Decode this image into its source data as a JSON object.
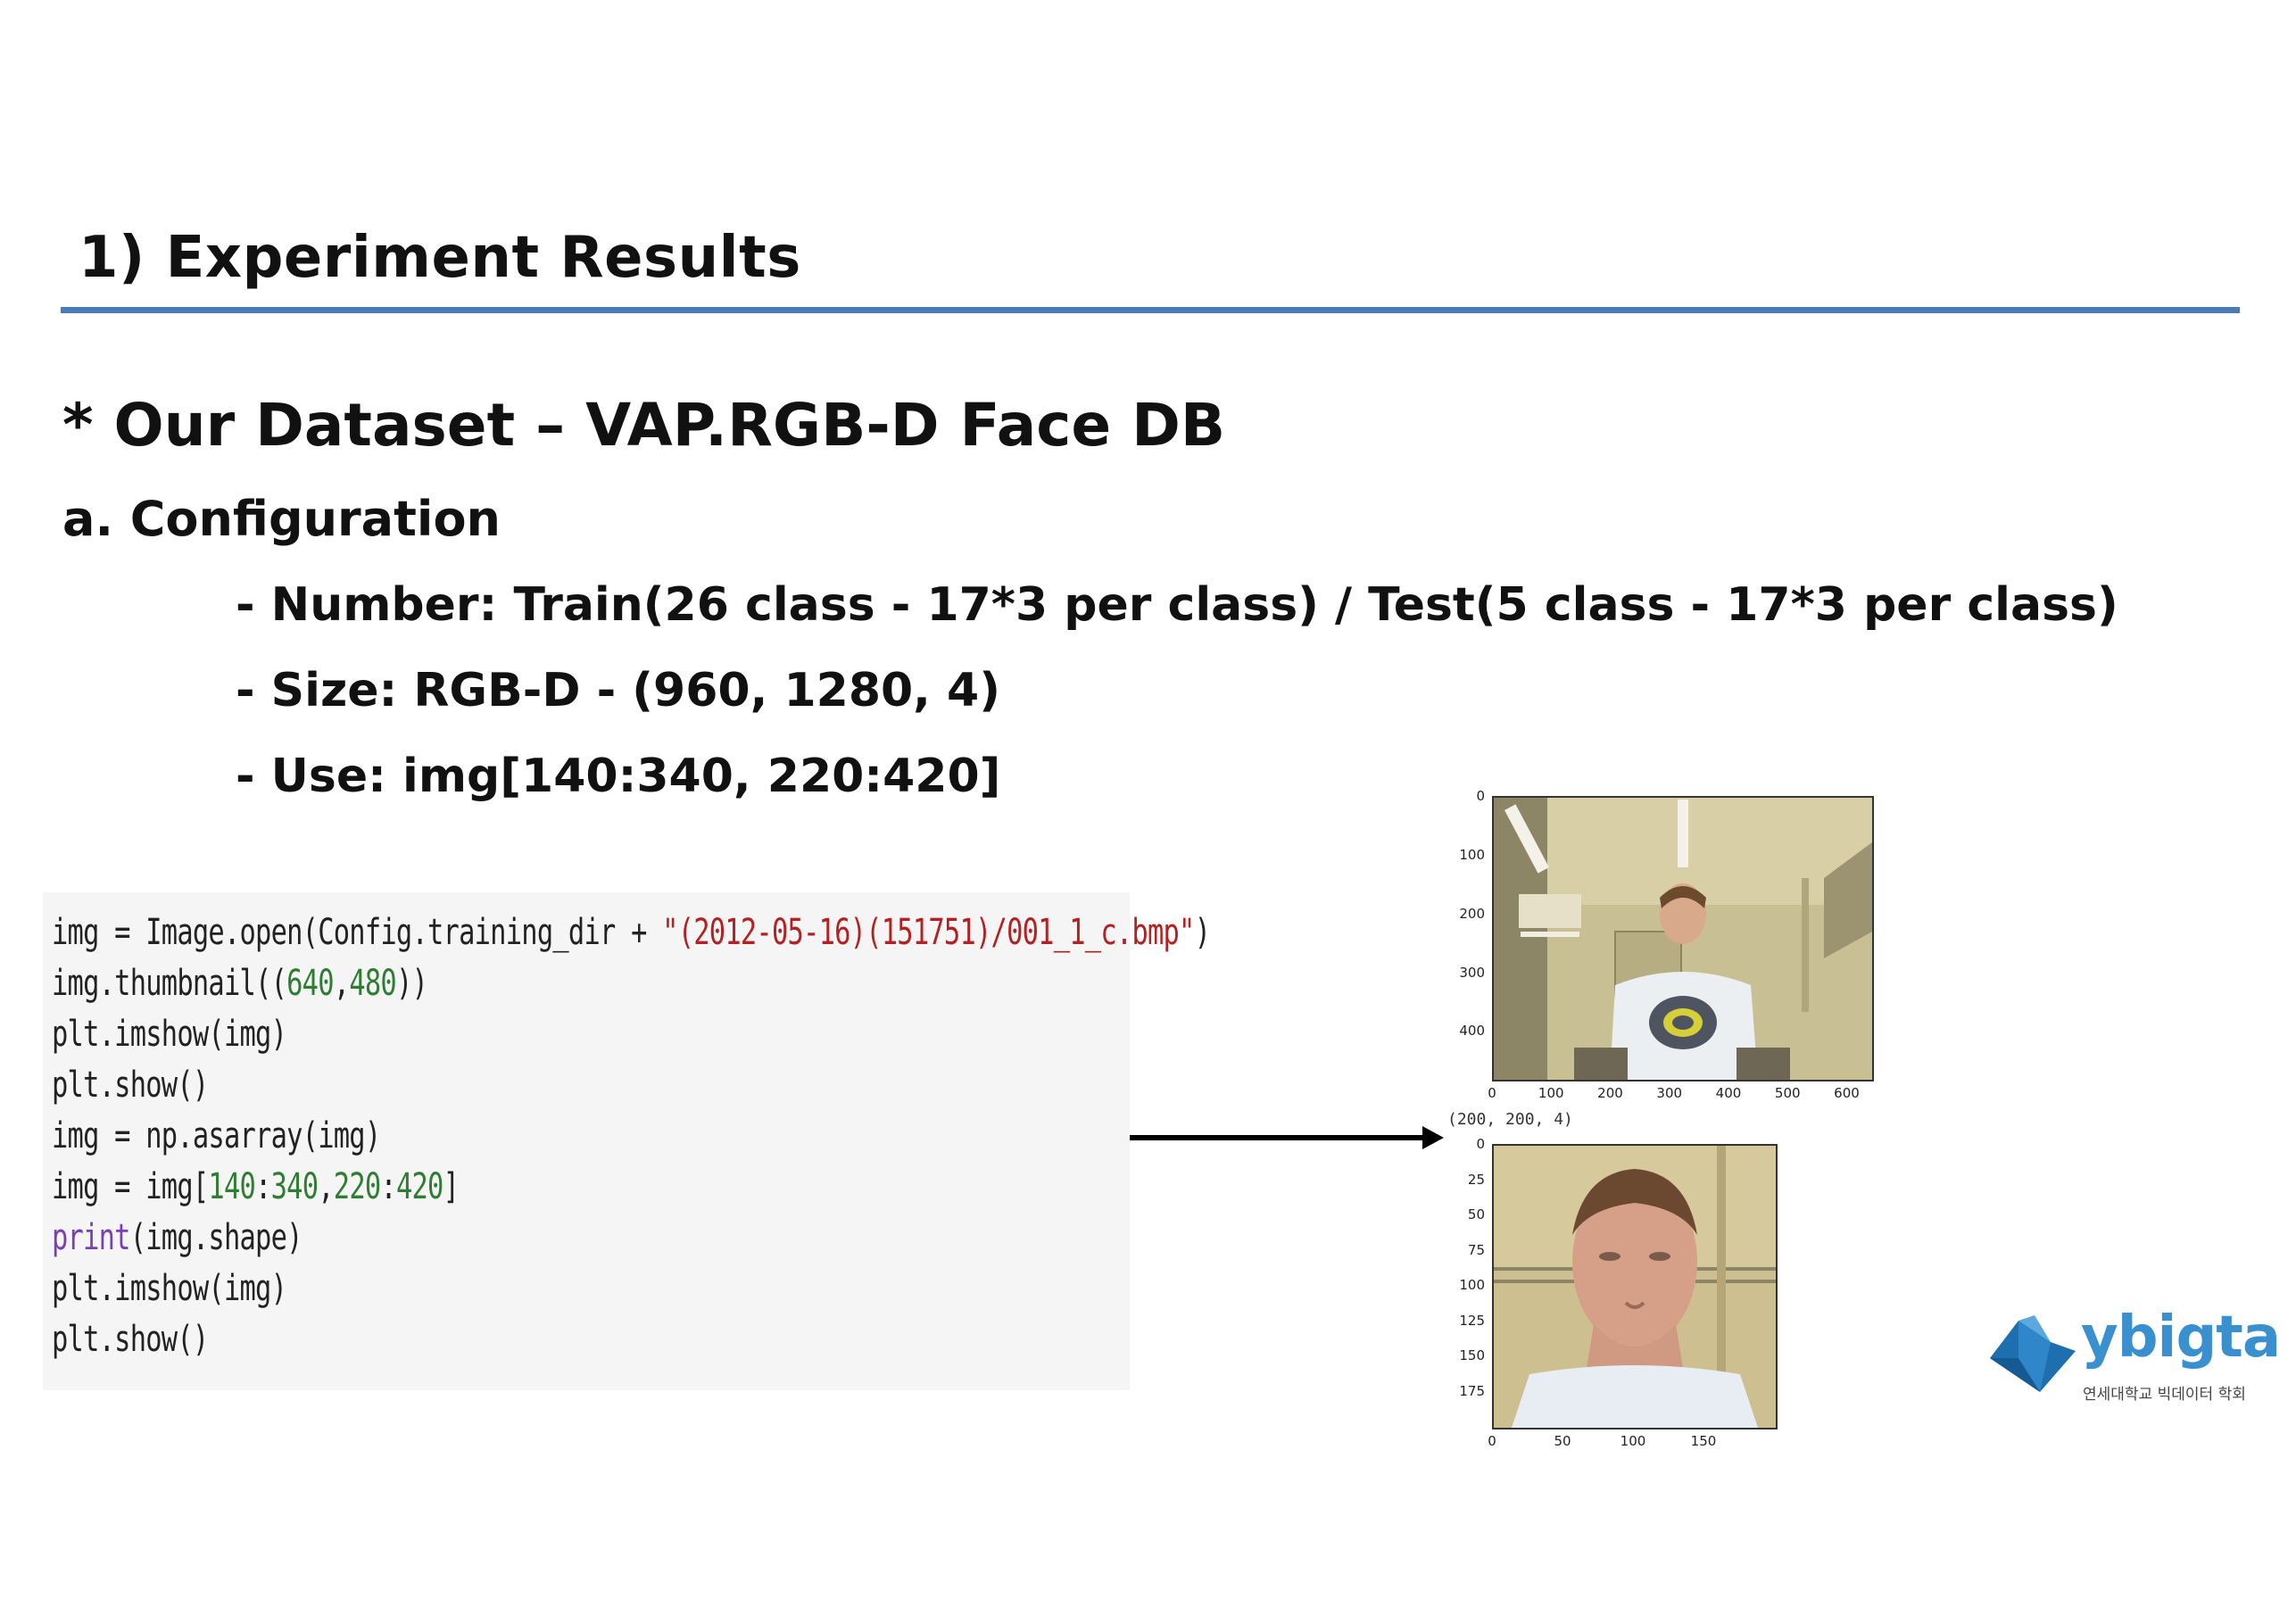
{
  "header": {
    "title": "1) Experiment Results"
  },
  "dataset": {
    "title": "* Our Dataset – VAP.RGB-D Face DB"
  },
  "configuration": {
    "heading": "a. Configuration",
    "bullets": [
      "- Number: Train(26 class - 17*3 per class) / Test(5 class - 17*3 per class)",
      "- Size: RGB-D - (960, 1280, 4)",
      "- Use: img[140:340, 220:420]"
    ]
  },
  "code": {
    "lines": [
      [
        {
          "t": "img = Image.open(Config.training_dir + ",
          "c": ""
        },
        {
          "t": "\"(2012-05-16)(151751)/001_1_c.bmp\"",
          "c": "str"
        },
        {
          "t": ")",
          "c": ""
        }
      ],
      [
        {
          "t": "img.thumbnail((",
          "c": ""
        },
        {
          "t": "640",
          "c": "num"
        },
        {
          "t": ",",
          "c": ""
        },
        {
          "t": "480",
          "c": "num"
        },
        {
          "t": "))",
          "c": ""
        }
      ],
      [
        {
          "t": "plt.imshow(img)",
          "c": ""
        }
      ],
      [
        {
          "t": "plt.show()",
          "c": ""
        }
      ],
      [
        {
          "t": "img = np.asarray(img)",
          "c": ""
        }
      ],
      [
        {
          "t": "img = img[",
          "c": ""
        },
        {
          "t": "140",
          "c": "num"
        },
        {
          "t": ":",
          "c": ""
        },
        {
          "t": "340",
          "c": "num"
        },
        {
          "t": ",",
          "c": ""
        },
        {
          "t": "220",
          "c": "num"
        },
        {
          "t": ":",
          "c": ""
        },
        {
          "t": "420",
          "c": "num"
        },
        {
          "t": "]",
          "c": ""
        }
      ],
      [
        {
          "t": "print",
          "c": "kw"
        },
        {
          "t": "(img.shape)",
          "c": ""
        }
      ],
      [
        {
          "t": "plt.imshow(img)",
          "c": ""
        }
      ],
      [
        {
          "t": "plt.show()",
          "c": ""
        }
      ]
    ]
  },
  "plot_full": {
    "x_ticks": [
      "0",
      "100",
      "200",
      "300",
      "400",
      "500",
      "600"
    ],
    "y_ticks": [
      "0",
      "100",
      "200",
      "300",
      "400"
    ]
  },
  "shape_output": "(200, 200, 4)",
  "plot_crop": {
    "x_ticks": [
      "0",
      "50",
      "100",
      "150"
    ],
    "y_ticks": [
      "0",
      "25",
      "50",
      "75",
      "100",
      "125",
      "150",
      "175"
    ]
  },
  "logo": {
    "name": "ybigta",
    "subtitle": "연세대학교 빅데이터 학회"
  },
  "colors": {
    "rule": "#4a7ab8",
    "code_bg": "#f5f5f5",
    "logo_blue": "#3a8fcf"
  }
}
